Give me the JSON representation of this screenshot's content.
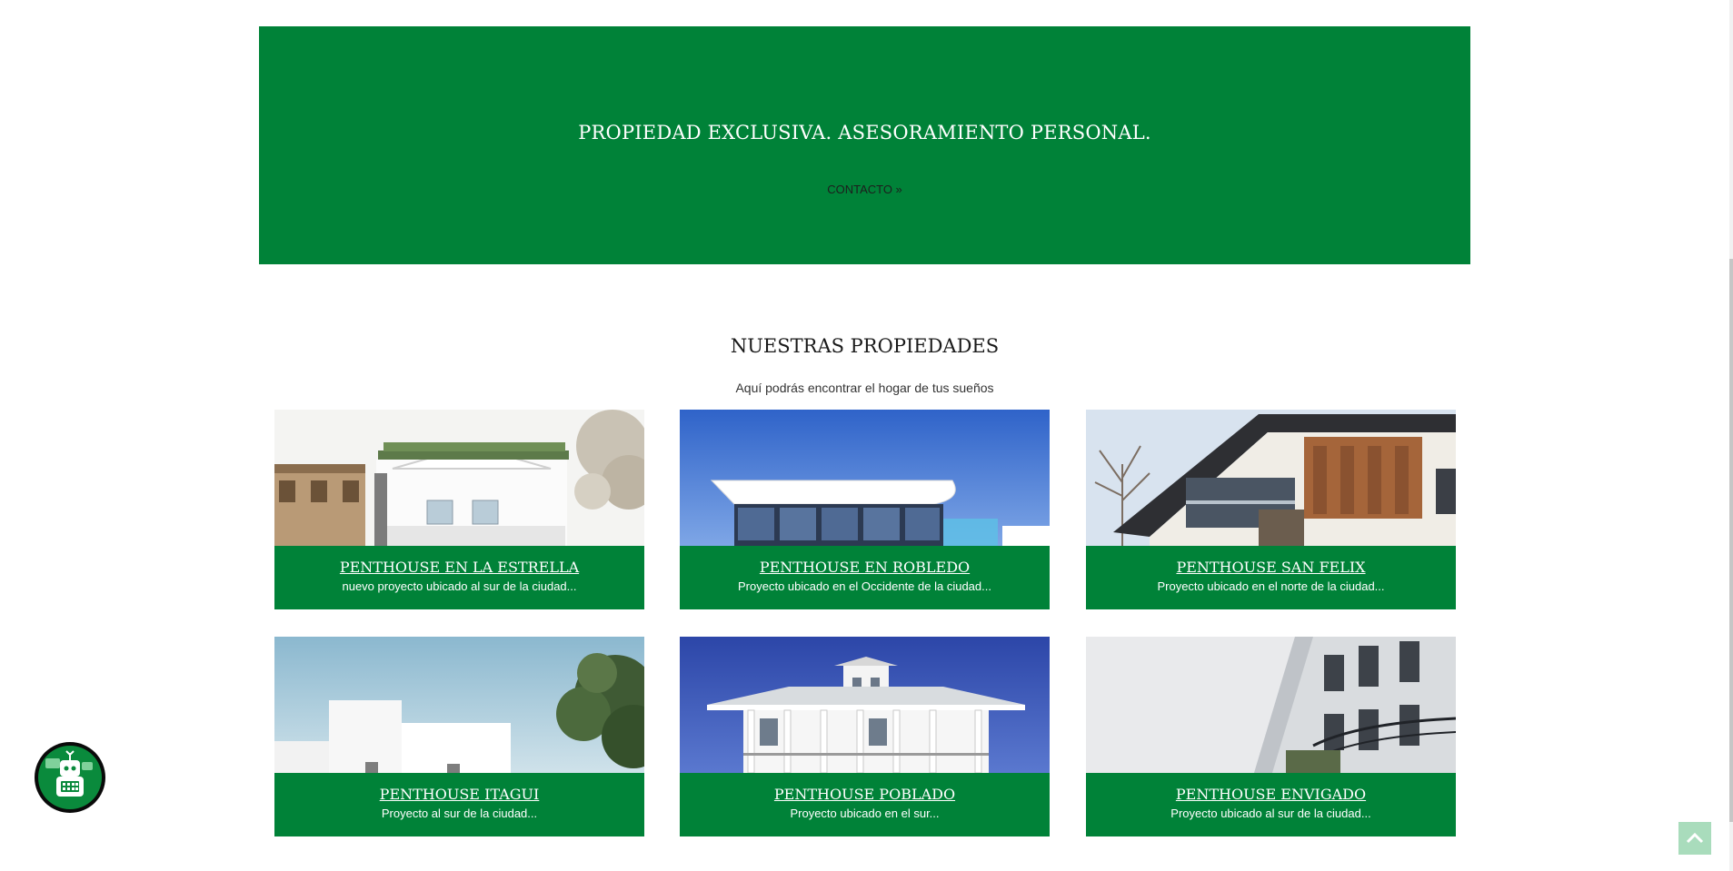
{
  "hero": {
    "title": "PROPIEDAD EXCLUSIVA. ASESORAMIENTO PERSONAL.",
    "link_label": "CONTACTO »",
    "background_color": "#008238"
  },
  "properties_section": {
    "title": "NUESTRAS PROPIEDADES",
    "subtitle": "Aquí podrás encontrar el hogar de tus sueños"
  },
  "properties": [
    {
      "title": "PENTHOUSE EN LA ESTRELLA",
      "description": "nuevo proyecto ubicado al sur de la ciudad..."
    },
    {
      "title": "PENTHOUSE EN ROBLEDO",
      "description": "Proyecto ubicado en el Occidente de la ciudad..."
    },
    {
      "title": "PENTHOUSE SAN FELIX",
      "description": "Proyecto ubicado en el norte de la ciudad..."
    },
    {
      "title": "PENTHOUSE ITAGUI",
      "description": "Proyecto al sur de la ciudad..."
    },
    {
      "title": "PENTHOUSE POBLADO",
      "description": "Proyecto ubicado en el sur..."
    },
    {
      "title": "PENTHOUSE ENVIGADO",
      "description": "Proyecto ubicado al sur de la ciudad..."
    }
  ],
  "widgets": {
    "chatbot_icon": "robot-icon",
    "scroll_top_icon": "chevron-up-icon"
  },
  "colors": {
    "brand_green": "#008238",
    "scroll_top": "#a9dcbc"
  }
}
